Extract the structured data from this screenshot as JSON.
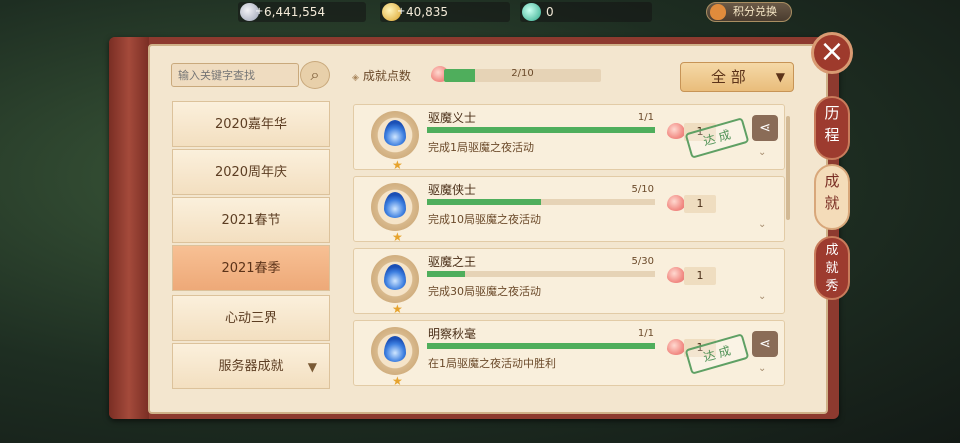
{
  "currencies": {
    "silver": "6,441,554",
    "gold": "40,835",
    "jade": "0",
    "points_button": "积分兑换"
  },
  "search": {
    "placeholder": "输入关键字查找"
  },
  "categories": [
    {
      "label": "2020嘉年华"
    },
    {
      "label": "2020周年庆"
    },
    {
      "label": "2021春节"
    },
    {
      "label": "2021春季"
    },
    {
      "label": "心动三界"
    },
    {
      "label": "服务器成就"
    }
  ],
  "header": {
    "points_label": "成就点数",
    "points_progress_text": "2/10",
    "points_progress": 0.2,
    "filter_label": "全 部"
  },
  "achievements": [
    {
      "name": "驱魔义士",
      "progress_text": "1/1",
      "progress": 1.0,
      "desc": "完成1局驱魔之夜活动",
      "reward": "1",
      "completed": true,
      "stamp": "达 成"
    },
    {
      "name": "驱魔侠士",
      "progress_text": "5/10",
      "progress": 0.5,
      "desc": "完成10局驱魔之夜活动",
      "reward": "1",
      "completed": false
    },
    {
      "name": "驱魔之王",
      "progress_text": "5/30",
      "progress": 0.167,
      "desc": "完成30局驱魔之夜活动",
      "reward": "1",
      "completed": false
    },
    {
      "name": "明察秋毫",
      "progress_text": "1/1",
      "progress": 1.0,
      "desc": "在1局驱魔之夜活动中胜利",
      "reward": "1",
      "completed": true,
      "stamp": "达 成"
    }
  ],
  "side_tabs": [
    {
      "label": "历程"
    },
    {
      "label": "成就"
    },
    {
      "label": "成就秀"
    }
  ],
  "icons": {
    "close": "close-icon",
    "search": "search-icon",
    "share": "share-icon",
    "chevron": "chevron-down-icon"
  }
}
